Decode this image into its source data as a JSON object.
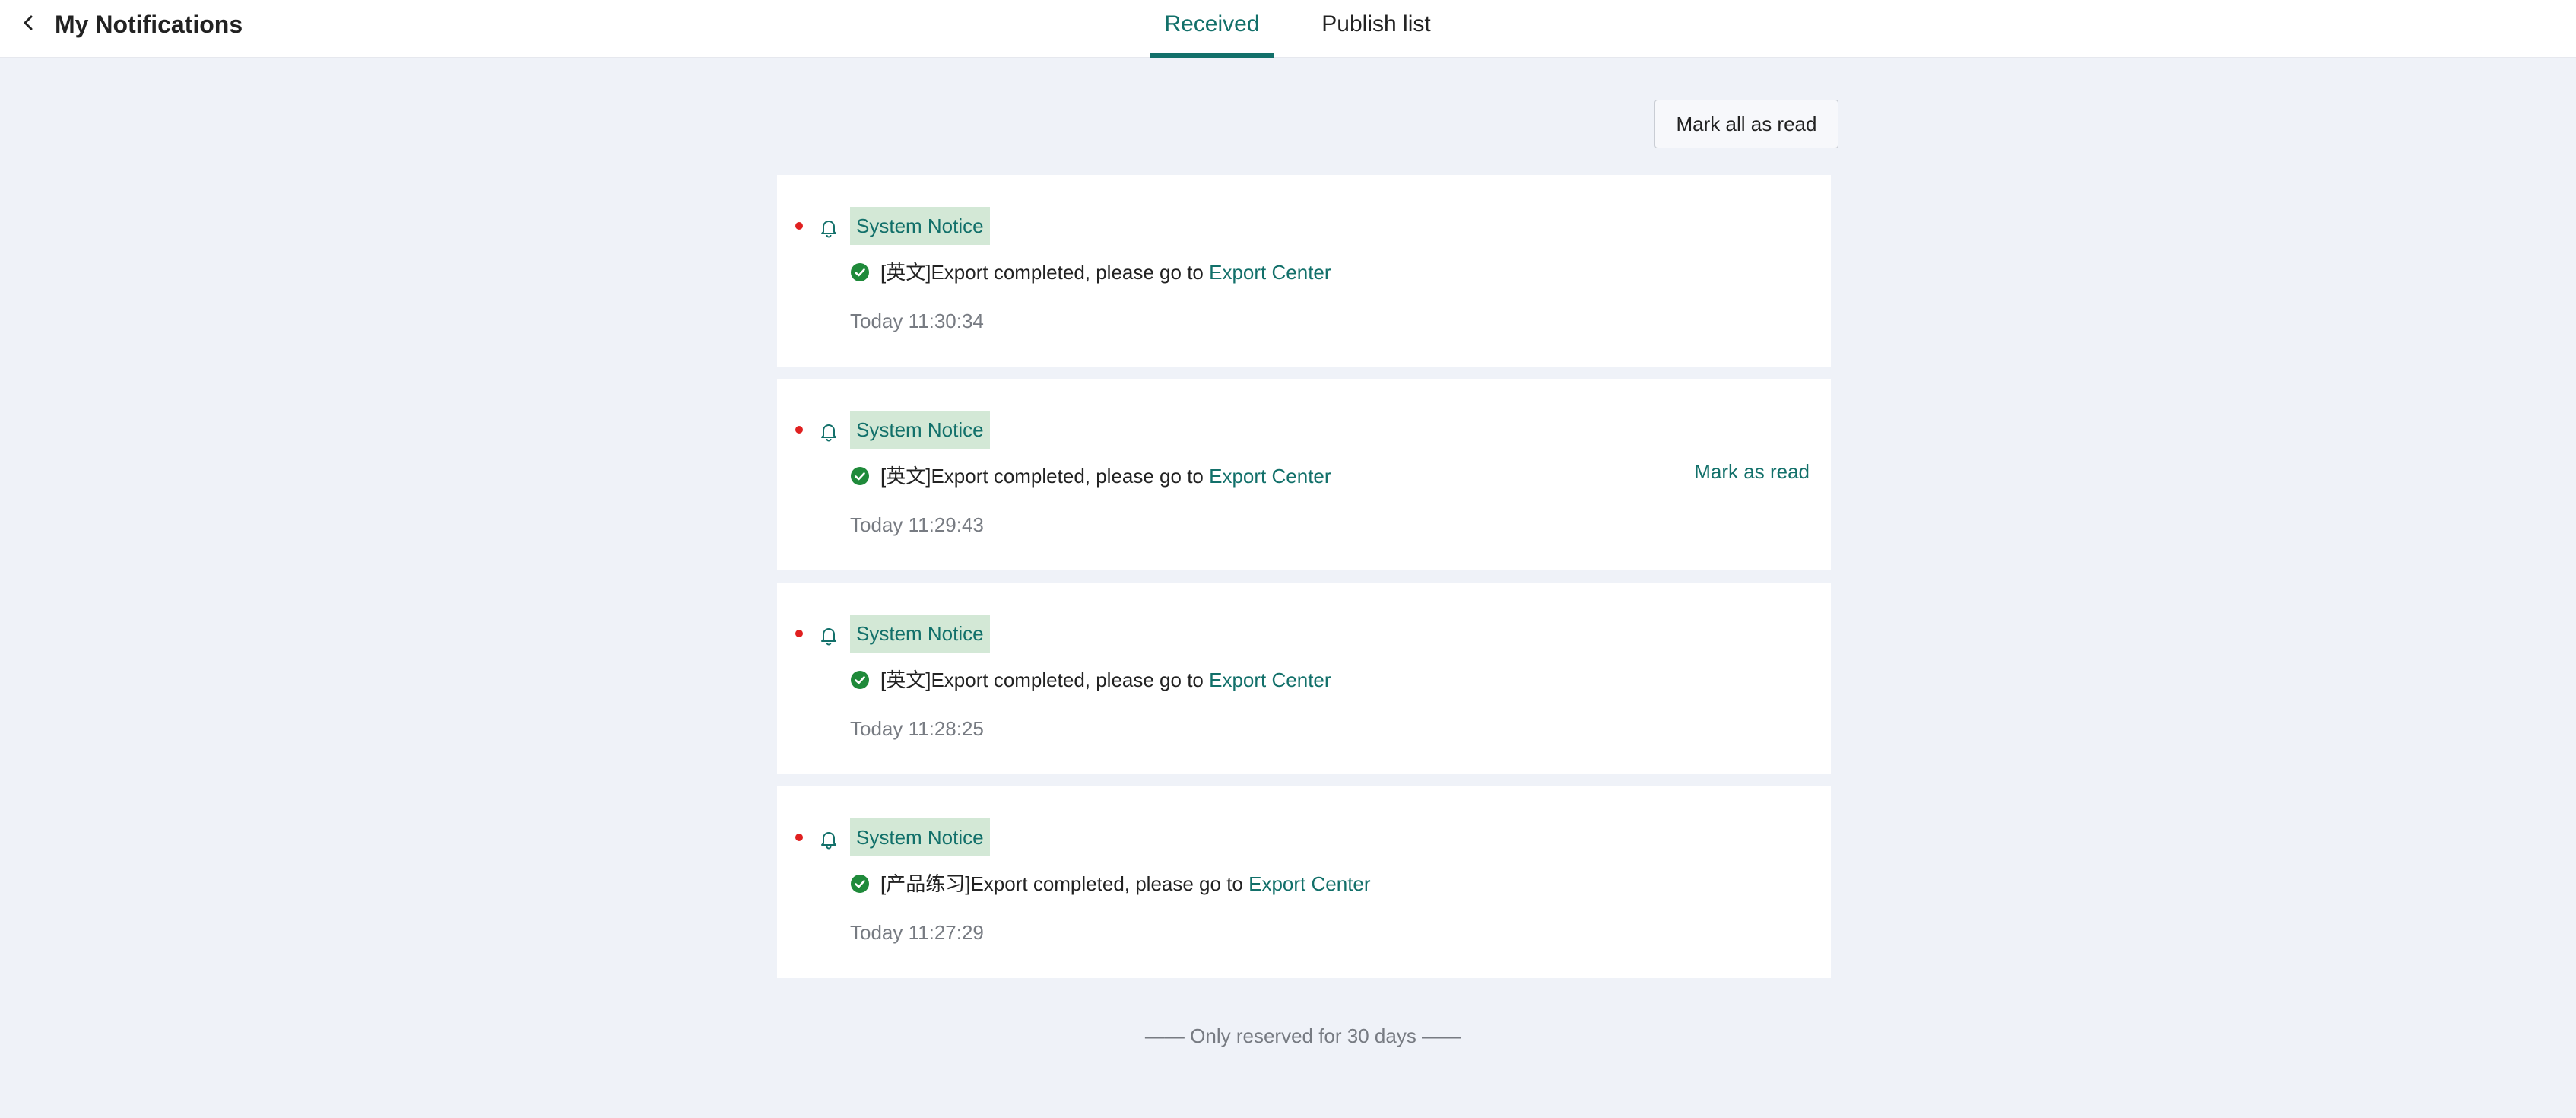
{
  "header": {
    "title": "My Notifications",
    "back_icon": "chevron-left-icon",
    "tabs": [
      {
        "label": "Received",
        "active": true
      },
      {
        "label": "Publish list",
        "active": false
      }
    ],
    "accent_color": "#12706a"
  },
  "toolbar": {
    "mark_all_label": "Mark all as read"
  },
  "notifications": [
    {
      "unread": true,
      "tag": "System Notice",
      "message_prefix": "[英文]Export completed, please go to ",
      "link_text": "Export Center",
      "time": "Today 11:30:34",
      "action_label": ""
    },
    {
      "unread": true,
      "tag": "System Notice",
      "message_prefix": "[英文]Export completed, please go to ",
      "link_text": "Export Center",
      "time": "Today 11:29:43",
      "action_label": "Mark as read"
    },
    {
      "unread": true,
      "tag": "System Notice",
      "message_prefix": "[英文]Export completed, please go to ",
      "link_text": "Export Center",
      "time": "Today 11:28:25",
      "action_label": ""
    },
    {
      "unread": true,
      "tag": "System Notice",
      "message_prefix": "[产品练习]Export completed, please go to ",
      "link_text": "Export Center",
      "time": "Today 11:27:29",
      "action_label": ""
    }
  ],
  "footer": {
    "note": "—— Only reserved for 30 days ——"
  },
  "colors": {
    "unread_dot": "#e02020",
    "tag_bg": "#d3e8d6",
    "check": "#1f8a3a",
    "page_bg": "#eff2f8"
  }
}
